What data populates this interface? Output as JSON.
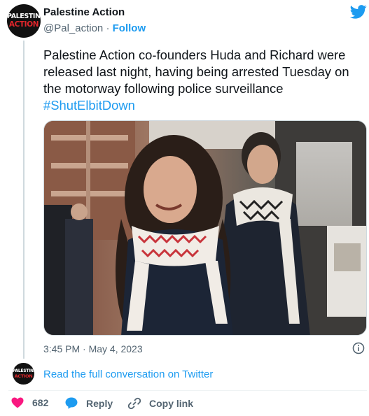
{
  "author": {
    "name": "Palestine Action",
    "handle": "@Pal_action",
    "separator": "·",
    "follow_label": "Follow",
    "avatar_text_top": "PALESTINE",
    "avatar_text_bottom": "ACTION"
  },
  "tweet": {
    "text": "Palestine Action co-founders Huda and Richard were released last night, having being arrested Tuesday on the motorway following police surveillance",
    "hashtag": "#ShutElbitDown",
    "timestamp": "3:45 PM · May 4, 2023",
    "photo_alt": "Photo of two activists wearing keffiyehs walking outdoors"
  },
  "conversation": {
    "read_full_label": "Read the full conversation on Twitter"
  },
  "actions": {
    "like_count": "682",
    "reply_label": "Reply",
    "copy_label": "Copy link"
  },
  "colors": {
    "twitter_blue": "#1d9bf0",
    "like_red": "#f91880",
    "text_secondary": "#536471"
  },
  "icons": [
    "twitter-bird-icon",
    "info-icon",
    "heart-icon",
    "reply-bubble-icon",
    "link-icon"
  ]
}
